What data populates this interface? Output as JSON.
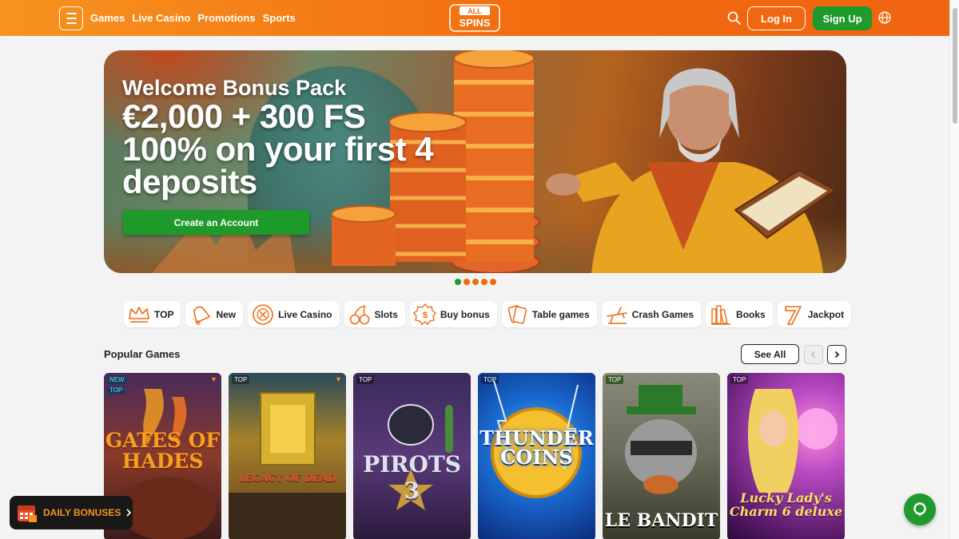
{
  "header": {
    "nav": [
      "Games",
      "Live Casino",
      "Promotions",
      "Sports"
    ],
    "logo": {
      "line1": "ALL",
      "line2": "SPINS"
    },
    "login_label": "Log In",
    "signup_label": "Sign Up"
  },
  "hero": {
    "line1": "Welcome Bonus Pack",
    "line2": "€2,000 + 300 FS",
    "line3": "100% on your first 4",
    "line4": "deposits",
    "cta_label": "Create an Account",
    "slides_count": 5,
    "active_slide": 1
  },
  "categories": [
    {
      "label": "TOP",
      "icon": "crown-icon"
    },
    {
      "label": "New",
      "icon": "bell-icon"
    },
    {
      "label": "Live Casino",
      "icon": "roulette-icon"
    },
    {
      "label": "Slots",
      "icon": "cherries-icon"
    },
    {
      "label": "Buy bonus",
      "icon": "bonus-badge-icon"
    },
    {
      "label": "Table games",
      "icon": "cards-icon"
    },
    {
      "label": "Crash Games",
      "icon": "plane-icon"
    },
    {
      "label": "Books",
      "icon": "books-icon"
    },
    {
      "label": "Jackpot",
      "icon": "seven-icon"
    }
  ],
  "popular": {
    "title": "Popular Games",
    "see_all_label": "See All",
    "games": [
      {
        "name": "GATES OF HADES",
        "badges": [
          "NEW",
          "TOP"
        ]
      },
      {
        "name": "LEGACY OF DEAD",
        "badges": [
          "TOP"
        ]
      },
      {
        "name": "PIROTS 3",
        "badges": [
          "TOP"
        ]
      },
      {
        "name": "THUNDER COINS",
        "badges": [
          "TOP"
        ]
      },
      {
        "name": "LE BANDIT",
        "badges": [
          "TOP"
        ]
      },
      {
        "name": "Lucky Lady's Charm 6 deluxe",
        "badges": [
          "TOP"
        ]
      }
    ]
  },
  "daily_bonuses_label": "DAILY BONUSES",
  "colors": {
    "brand_orange": "#f26a0f",
    "brand_green": "#1f9a2c"
  }
}
